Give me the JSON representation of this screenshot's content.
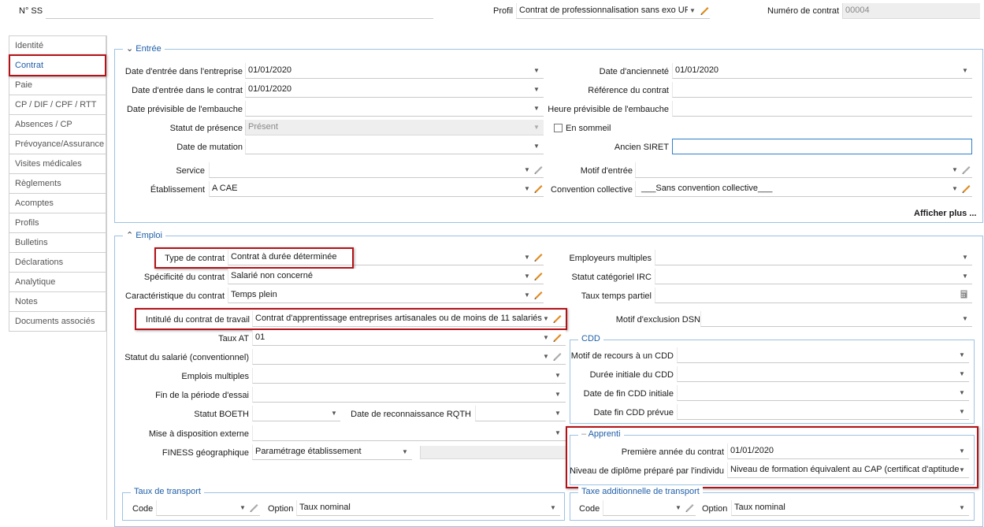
{
  "header": {
    "nss_label": "N° SS",
    "nss_value": "",
    "profil_label": "Profil",
    "profil_value": "Contrat de professionnalisation sans exo UF",
    "contract_number_label": "Numéro de contrat",
    "contract_number_value": "00004"
  },
  "sidebar": {
    "items": [
      {
        "label": "Identité"
      },
      {
        "label": "Contrat"
      },
      {
        "label": "Paie"
      },
      {
        "label": "CP / DIF / CPF / RTT"
      },
      {
        "label": "Absences / CP"
      },
      {
        "label": "Prévoyance/Assurance"
      },
      {
        "label": "Visites médicales"
      },
      {
        "label": "Règlements"
      },
      {
        "label": "Acomptes"
      },
      {
        "label": "Profils"
      },
      {
        "label": "Bulletins"
      },
      {
        "label": "Déclarations"
      },
      {
        "label": "Analytique"
      },
      {
        "label": "Notes"
      },
      {
        "label": "Documents associés"
      }
    ],
    "active": "Contrat"
  },
  "entree": {
    "title": "Entrée",
    "date_entree_entreprise": {
      "label": "Date d'entrée dans l'entreprise",
      "value": "01/01/2020"
    },
    "date_entree_contrat": {
      "label": "Date d'entrée dans le contrat",
      "value": "01/01/2020"
    },
    "date_previsible_embauche": {
      "label": "Date prévisible de l'embauche",
      "value": ""
    },
    "statut_presence": {
      "label": "Statut de présence",
      "value": "Présent"
    },
    "date_mutation": {
      "label": "Date de mutation",
      "value": ""
    },
    "service": {
      "label": "Service",
      "value": ""
    },
    "etablissement": {
      "label": "Établissement",
      "value": "A CAE"
    },
    "date_anciennete": {
      "label": "Date d'ancienneté",
      "value": "01/01/2020"
    },
    "reference_contrat": {
      "label": "Référence du contrat",
      "value": ""
    },
    "heure_previsible": {
      "label": "Heure prévisible de l'embauche",
      "value": ""
    },
    "en_sommeil": {
      "label": "En sommeil",
      "checked": false
    },
    "ancien_siret": {
      "label": "Ancien SIRET",
      "value": ""
    },
    "motif_entree": {
      "label": "Motif d'entrée",
      "value": ""
    },
    "convention_collective": {
      "label": "Convention collective",
      "value": "___Sans convention collective___"
    },
    "afficher_plus": "Afficher plus ..."
  },
  "emploi": {
    "title": "Emploi",
    "type_contrat": {
      "label": "Type de contrat",
      "value": "Contrat à durée déterminée"
    },
    "specificite_contrat": {
      "label": "Spécificité du contrat",
      "value": "Salarié non concerné"
    },
    "caracteristique_contrat": {
      "label": "Caractéristique du contrat",
      "value": "Temps plein"
    },
    "intitule_contrat": {
      "label": "Intitulé du contrat de travail",
      "value": "Contrat d'apprentissage entreprises artisanales ou de moins de 11 salariés"
    },
    "taux_at": {
      "label": "Taux AT",
      "value": "01"
    },
    "statut_salarie": {
      "label": "Statut du salarié (conventionnel)",
      "value": ""
    },
    "emplois_multiples": {
      "label": "Emplois multiples",
      "value": ""
    },
    "fin_periode_essai": {
      "label": "Fin de la période d'essai",
      "value": ""
    },
    "statut_boeth": {
      "label": "Statut BOETH",
      "value": ""
    },
    "date_reconnaissance_rqth": {
      "label": "Date de reconnaissance RQTH",
      "value": ""
    },
    "mise_disposition": {
      "label": "Mise à disposition externe",
      "value": ""
    },
    "finess": {
      "label": "FINESS géographique",
      "value": "Paramétrage établissement"
    },
    "employeurs_multiples": {
      "label": "Employeurs multiples",
      "value": ""
    },
    "statut_categoriel": {
      "label": "Statut catégoriel IRC",
      "value": ""
    },
    "taux_temps_partiel": {
      "label": "Taux temps partiel",
      "value": ""
    },
    "motif_exclusion": {
      "label": "Motif d'exclusion DSN",
      "value": ""
    },
    "cdd": {
      "title": "CDD",
      "motif_recours": {
        "label": "Motif de recours à un CDD",
        "value": ""
      },
      "duree_initiale": {
        "label": "Durée initiale du CDD",
        "value": ""
      },
      "date_fin_initiale": {
        "label": "Date de fin CDD initiale",
        "value": ""
      },
      "date_fin_prevue": {
        "label": "Date fin CDD prévue",
        "value": ""
      }
    },
    "apprenti": {
      "title": "Apprenti",
      "premiere_annee": {
        "label": "Première année du contrat",
        "value": "01/01/2020"
      },
      "niveau_diplome": {
        "label": "Niveau de diplôme préparé par l'individu",
        "value": "Niveau de formation équivalent au CAP (certificat d'aptitude"
      }
    },
    "taux_transport": {
      "title": "Taux de transport",
      "code_label": "Code",
      "code_value": "",
      "option_label": "Option",
      "option_value": "Taux nominal"
    },
    "taxe_transport": {
      "title": "Taxe additionnelle de transport",
      "code_label": "Code",
      "code_value": "",
      "option_label": "Option",
      "option_value": "Taux nominal"
    }
  },
  "colors": {
    "accent": "#1f5fa8",
    "highlight_border": "#b31217",
    "group_border": "#9cc2e2"
  }
}
